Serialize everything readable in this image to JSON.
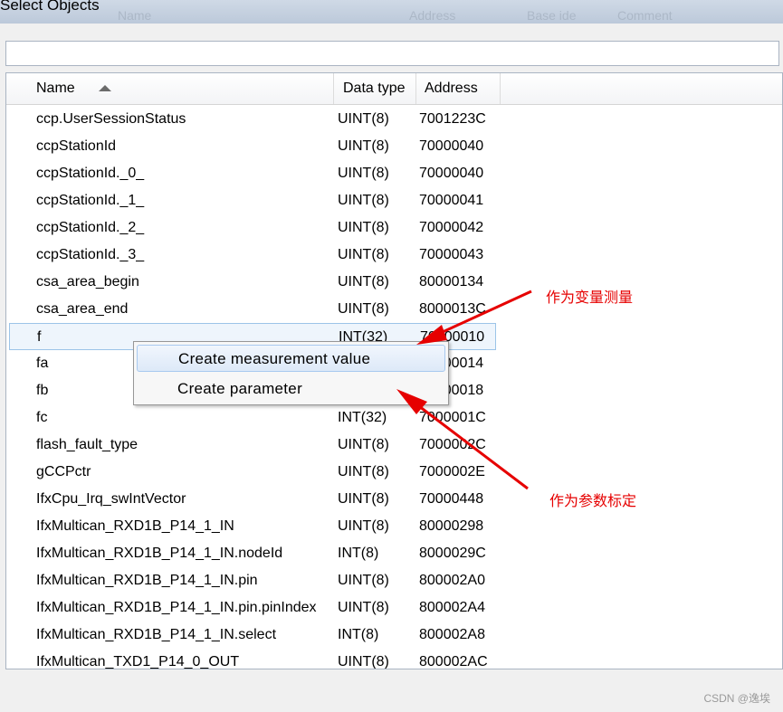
{
  "window": {
    "title": "Select Objects",
    "ghost_labels": [
      "Name",
      "Address",
      "Base ide",
      "Comment"
    ]
  },
  "filter": {
    "value": "",
    "placeholder": ""
  },
  "columns": [
    {
      "label": "Name"
    },
    {
      "label": "Data type"
    },
    {
      "label": "Address"
    }
  ],
  "rows": [
    {
      "name": "ccp.UserSessionStatus",
      "type": "UINT(8)",
      "address": "7001223C"
    },
    {
      "name": "ccpStationId",
      "type": "UINT(8)",
      "address": "70000040"
    },
    {
      "name": "ccpStationId._0_",
      "type": "UINT(8)",
      "address": "70000040"
    },
    {
      "name": "ccpStationId._1_",
      "type": "UINT(8)",
      "address": "70000041"
    },
    {
      "name": "ccpStationId._2_",
      "type": "UINT(8)",
      "address": "70000042"
    },
    {
      "name": "ccpStationId._3_",
      "type": "UINT(8)",
      "address": "70000043"
    },
    {
      "name": "csa_area_begin",
      "type": "UINT(8)",
      "address": "80000134"
    },
    {
      "name": "csa_area_end",
      "type": "UINT(8)",
      "address": "8000013C"
    },
    {
      "name": "f",
      "type": "INT(32)",
      "address": "70000010"
    },
    {
      "name": "fa",
      "type": "",
      "address": "70000014"
    },
    {
      "name": "fb",
      "type": "",
      "address": "70000018"
    },
    {
      "name": "fc",
      "type": "INT(32)",
      "address": "7000001C"
    },
    {
      "name": "flash_fault_type",
      "type": "UINT(8)",
      "address": "7000002C"
    },
    {
      "name": "gCCPctr",
      "type": "UINT(8)",
      "address": "7000002E"
    },
    {
      "name": "IfxCpu_Irq_swIntVector",
      "type": "UINT(8)",
      "address": "70000448"
    },
    {
      "name": "IfxMultican_RXD1B_P14_1_IN",
      "type": "UINT(8)",
      "address": "80000298"
    },
    {
      "name": "IfxMultican_RXD1B_P14_1_IN.nodeId",
      "type": "INT(8)",
      "address": "8000029C"
    },
    {
      "name": "IfxMultican_RXD1B_P14_1_IN.pin",
      "type": "UINT(8)",
      "address": "800002A0"
    },
    {
      "name": "IfxMultican_RXD1B_P14_1_IN.pin.pinIndex",
      "type": "UINT(8)",
      "address": "800002A4"
    },
    {
      "name": "IfxMultican_RXD1B_P14_1_IN.select",
      "type": "INT(8)",
      "address": "800002A8"
    },
    {
      "name": "IfxMultican_TXD1_P14_0_OUT",
      "type": "UINT(8)",
      "address": "800002AC"
    }
  ],
  "context_menu": {
    "items": [
      {
        "label": "Create measurement value"
      },
      {
        "label": "Create parameter"
      }
    ]
  },
  "annotations": {
    "measurement": "作为变量测量",
    "parameter": "作为参数标定",
    "color": "#e60000"
  },
  "watermark": "CSDN @逸埃"
}
